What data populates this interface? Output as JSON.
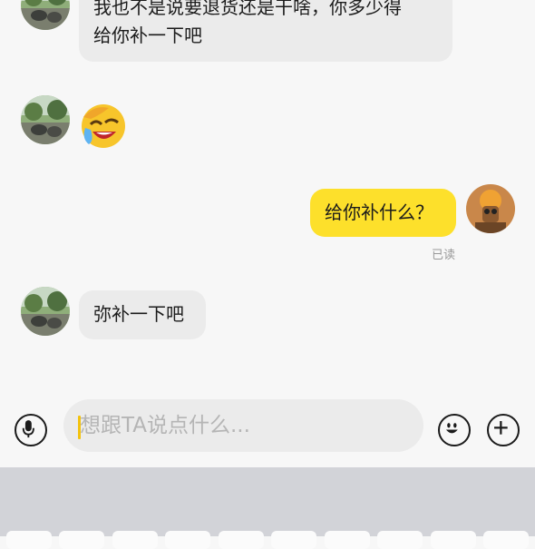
{
  "messages": [
    {
      "side": "in",
      "text_line1": "我也不是说要退货还是干啥，你多少得",
      "text_line2": "给你补一下吧"
    },
    {
      "side": "in",
      "emoji": "crying-laughing-emoji"
    },
    {
      "side": "out",
      "text": "给你补什么？",
      "status": "已读"
    },
    {
      "side": "in",
      "text": "弥补一下吧"
    }
  ],
  "input": {
    "placeholder": "想跟TA说点什么..."
  },
  "icons": {
    "voice": "microphone-icon",
    "emoji": "smiley-icon",
    "more": "plus-icon"
  },
  "colors": {
    "outgoing_bubble": "#fde02b",
    "incoming_bubble": "#ebebeb",
    "caret": "#f3c20d",
    "keyboard": "#d2d3d8"
  }
}
